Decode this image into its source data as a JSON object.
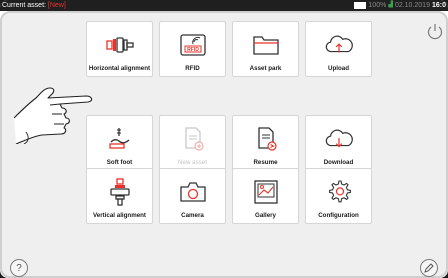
{
  "status": {
    "asset_prefix": "Current asset: ",
    "asset_value": "[New]",
    "battery_pct": "100%",
    "date": "02.10.2019",
    "time": "16:0"
  },
  "tiles": [
    {
      "label": "Horizontal alignment",
      "icon": "horizontal-alignment-icon",
      "enabled": true
    },
    {
      "label": "RFID",
      "icon": "rfid-icon",
      "enabled": true
    },
    {
      "label": "Asset park",
      "icon": "folder-icon",
      "enabled": true
    },
    {
      "label": "Upload",
      "icon": "cloud-upload-icon",
      "enabled": true
    },
    {
      "label": "Soft foot",
      "icon": "soft-foot-icon",
      "enabled": true
    },
    {
      "label": "New asset",
      "icon": "new-asset-icon",
      "enabled": false
    },
    {
      "label": "Resume",
      "icon": "resume-icon",
      "enabled": true
    },
    {
      "label": "Download",
      "icon": "cloud-download-icon",
      "enabled": true
    },
    {
      "label": "Vertical alignment",
      "icon": "vertical-alignment-icon",
      "enabled": true
    },
    {
      "label": "Camera",
      "icon": "camera-icon",
      "enabled": true
    },
    {
      "label": "Gallery",
      "icon": "gallery-icon",
      "enabled": true
    },
    {
      "label": "Configuration",
      "icon": "gear-icon",
      "enabled": true
    }
  ],
  "corner_buttons": {
    "top_right": "power-icon",
    "bottom_left": "help-icon",
    "bottom_right": "edit-icon"
  },
  "colors": {
    "accent": "#e8332a",
    "status_bar": "#1f1f1f",
    "signal": "#3aa04a",
    "background": "#efefef"
  }
}
